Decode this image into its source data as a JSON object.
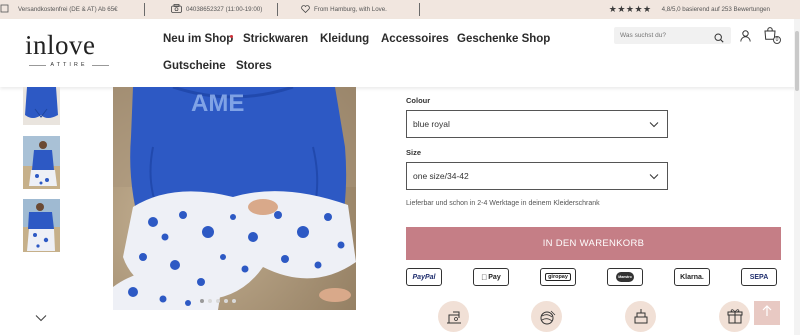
{
  "topbar": {
    "shipping": "Versandkostenfrei (DE & AT) Ab 65€",
    "phone": "04038652327 (11:00-19:00)",
    "origin": "From Hamburg, with Love.",
    "stars": "★★★★★",
    "rating_text": "4,8/5,0 basierend auf 253 Bewertungen"
  },
  "logo": {
    "word": "inlove",
    "sub": "ATTIRE"
  },
  "nav": {
    "items": [
      "Neu im Shop",
      "Strickwaren",
      "Kleidung",
      "Accessoires",
      "Geschenke Shop",
      "Gutscheine",
      "Stores"
    ]
  },
  "search": {
    "placeholder": "Was suchst du?"
  },
  "cart": {
    "count": "0"
  },
  "options": {
    "colour_label": "Colour",
    "colour_value": "blue royal",
    "size_label": "Size",
    "size_value": "one size/34-42"
  },
  "delivery": "Lieferbar und schon in 2-4 Werktage in deinem Kleiderschrank",
  "add_to_cart": "IN DEN WARENKORB",
  "payments": [
    "PayPal",
    "Pay",
    "giropay",
    "Maestro",
    "Klarna.",
    "SEPA"
  ],
  "carousel": {
    "dots": 5,
    "active": 1
  },
  "icons": {
    "phone": "phone-icon",
    "heart": "heart-icon",
    "search": "search-icon",
    "user": "user-icon",
    "cart": "bag-icon",
    "chevron": "chevron-down-icon",
    "totop": "arrow-up-icon"
  },
  "colors": {
    "topbar_bg": "#f1e6df",
    "accent": "#c57e86",
    "feature_bg": "#f1e0d6",
    "product_blue": "#2d59c4"
  }
}
